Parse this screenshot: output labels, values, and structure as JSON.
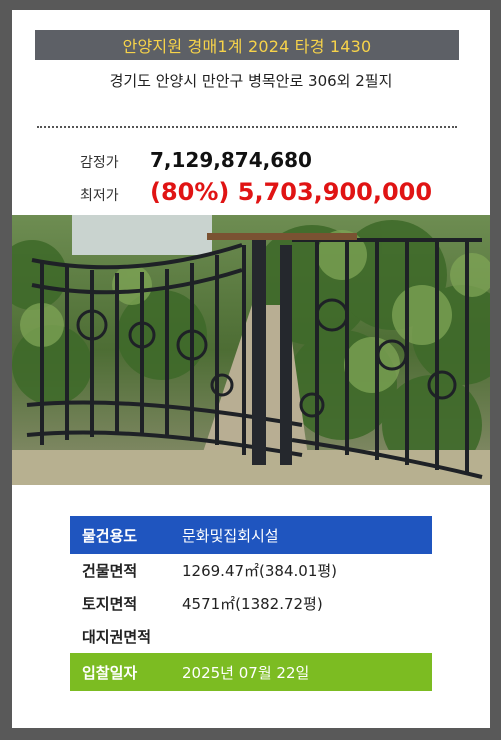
{
  "header": {
    "title": "안양지원 경매1계 2024 타경 1430",
    "address": "경기도 안양시 만안구 병목안로 306외 2필지"
  },
  "prices": {
    "appraisal_label": "감정가",
    "appraisal_value": "7,129,874,680",
    "minimum_label": "최저가",
    "minimum_value": "(80%) 5,703,900,000"
  },
  "photo": {
    "subject": "iron gate with overgrown ivy"
  },
  "details": {
    "usage_label": "물건용도",
    "usage_value": "문화및집회시설",
    "building_area_label": "건물면적",
    "building_area_value": "1269.47㎡(384.01평)",
    "land_area_label": "토지면적",
    "land_area_value": "4571㎡(1382.72평)",
    "land_right_label": "대지권면적",
    "land_right_value": "",
    "bid_date_label": "입찰일자",
    "bid_date_value": "2025년 07월 22일"
  },
  "colors": {
    "title_bg": "#5d6066",
    "title_text": "#f7d34a",
    "minimum_price": "#e01414",
    "usage_row_bg": "#1f55bf",
    "bid_row_bg": "#7cbc22"
  }
}
